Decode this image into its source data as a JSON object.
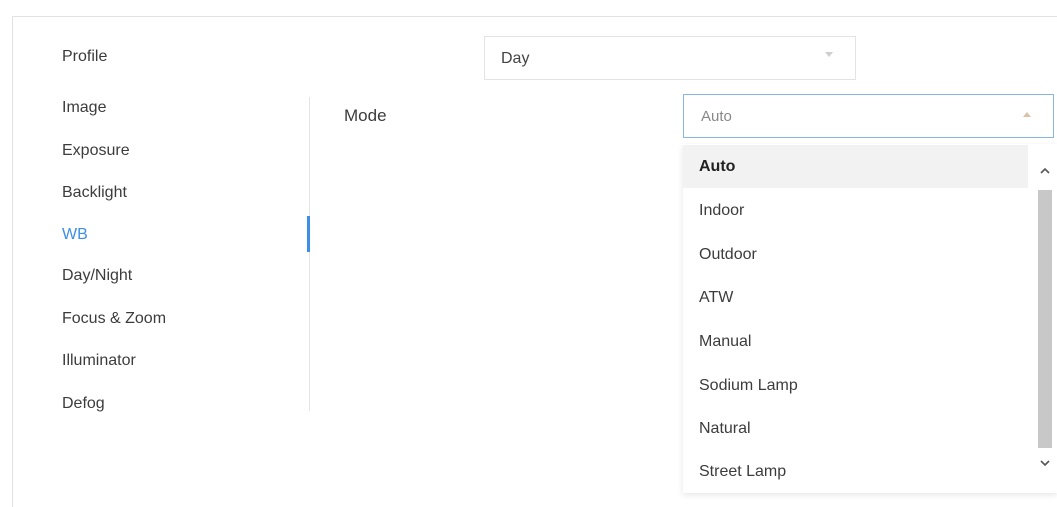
{
  "profile": {
    "label": "Profile",
    "value": "Day"
  },
  "sidebar": {
    "items": [
      {
        "label": "Image",
        "active": false
      },
      {
        "label": "Exposure",
        "active": false
      },
      {
        "label": "Backlight",
        "active": false
      },
      {
        "label": "WB",
        "active": true
      },
      {
        "label": "Day/Night",
        "active": false
      },
      {
        "label": "Focus & Zoom",
        "active": false
      },
      {
        "label": "Illuminator",
        "active": false
      },
      {
        "label": "Defog",
        "active": false
      }
    ]
  },
  "mode": {
    "label": "Mode",
    "value": "Auto",
    "options": [
      "Auto",
      "Indoor",
      "Outdoor",
      "ATW",
      "Manual",
      "Sodium Lamp",
      "Natural",
      "Street Lamp"
    ],
    "selected_index": 0
  },
  "colors": {
    "accent": "#3d8fe6",
    "selected_bg": "#f2f2f2",
    "border": "#e3e3e3"
  },
  "icons": {
    "profile_caret": "chevron-down-icon",
    "mode_caret": "chevron-up-icon",
    "scroll_up": "scroll-up-arrow-icon",
    "scroll_down": "scroll-down-arrow-icon"
  }
}
